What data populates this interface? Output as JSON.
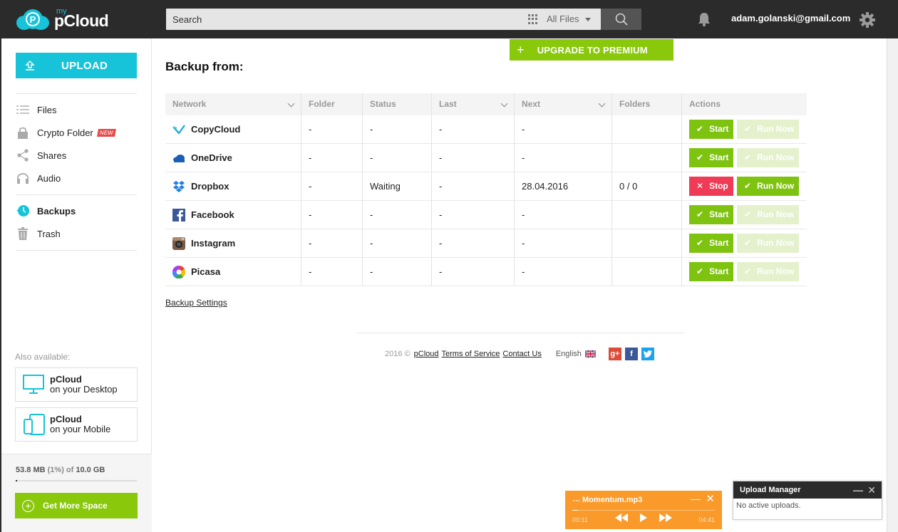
{
  "header": {
    "logo_my": "my",
    "logo_name": "pCloud",
    "search_placeholder": "Search",
    "filter_label": "All Files",
    "user_email": "adam.golanski@gmail.com"
  },
  "sidebar": {
    "upload_label": "UPLOAD",
    "nav": [
      {
        "label": "Files",
        "icon": "list-icon"
      },
      {
        "label": "Crypto Folder",
        "icon": "lock-icon",
        "badge": "NEW"
      },
      {
        "label": "Shares",
        "icon": "share-icon"
      },
      {
        "label": "Audio",
        "icon": "headphones-icon"
      },
      {
        "label": "Backups",
        "icon": "backup-clock-icon",
        "active": true
      },
      {
        "label": "Trash",
        "icon": "trash-icon"
      }
    ],
    "also_available": "Also available:",
    "desktop": {
      "title": "pCloud",
      "subtitle": "on your Desktop"
    },
    "mobile": {
      "title": "pCloud",
      "subtitle": "on your Mobile"
    },
    "storage": {
      "used": "53.8 MB",
      "percent_text": "(1%) of",
      "total": "10.0 GB",
      "fraction": 0.01
    },
    "more_space_label": "Get More Space"
  },
  "main": {
    "upgrade_label": "UPGRADE TO PREMIUM",
    "title": "Backup from:",
    "columns": [
      "Network",
      "Folder",
      "Status",
      "Last",
      "Next",
      "Folders",
      "Actions"
    ],
    "rows": [
      {
        "network": "CopyCloud",
        "icon": "copycloud-icon",
        "folder": "-",
        "status": "-",
        "last": "-",
        "next": "-",
        "folders": "",
        "action": "Start",
        "run": "Run Now",
        "run_enabled": false
      },
      {
        "network": "OneDrive",
        "icon": "onedrive-icon",
        "folder": "-",
        "status": "-",
        "last": "-",
        "next": "-",
        "folders": "",
        "action": "Start",
        "run": "Run Now",
        "run_enabled": false
      },
      {
        "network": "Dropbox",
        "icon": "dropbox-icon",
        "folder": "-",
        "status": "Waiting",
        "last": "-",
        "next": "28.04.2016",
        "folders": "0 / 0",
        "action": "Stop",
        "run": "Run Now",
        "run_enabled": true
      },
      {
        "network": "Facebook",
        "icon": "facebook-icon",
        "folder": "-",
        "status": "-",
        "last": "-",
        "next": "-",
        "folders": "",
        "action": "Start",
        "run": "Run Now",
        "run_enabled": false
      },
      {
        "network": "Instagram",
        "icon": "instagram-icon",
        "folder": "-",
        "status": "-",
        "last": "-",
        "next": "-",
        "folders": "",
        "action": "Start",
        "run": "Run Now",
        "run_enabled": false
      },
      {
        "network": "Picasa",
        "icon": "picasa-icon",
        "folder": "-",
        "status": "-",
        "last": "-",
        "next": "-",
        "folders": "",
        "action": "Start",
        "run": "Run Now",
        "run_enabled": false
      }
    ],
    "backup_settings": "Backup Settings"
  },
  "footer": {
    "copyright": "2016 ©",
    "brand": "pCloud",
    "tos": "Terms of Service",
    "contact": "Contact Us",
    "language": "English"
  },
  "player": {
    "title": "Momentum.mp3",
    "current": "00:11",
    "duration": "04:41",
    "progress": 0.04
  },
  "upload_manager": {
    "title": "Upload Manager",
    "status": "No active uploads."
  },
  "colors": {
    "accent": "#17c3d8",
    "green": "#7ec310",
    "stop": "#ef3b55",
    "header": "#2b2b2b",
    "player": "#f99a2a"
  }
}
